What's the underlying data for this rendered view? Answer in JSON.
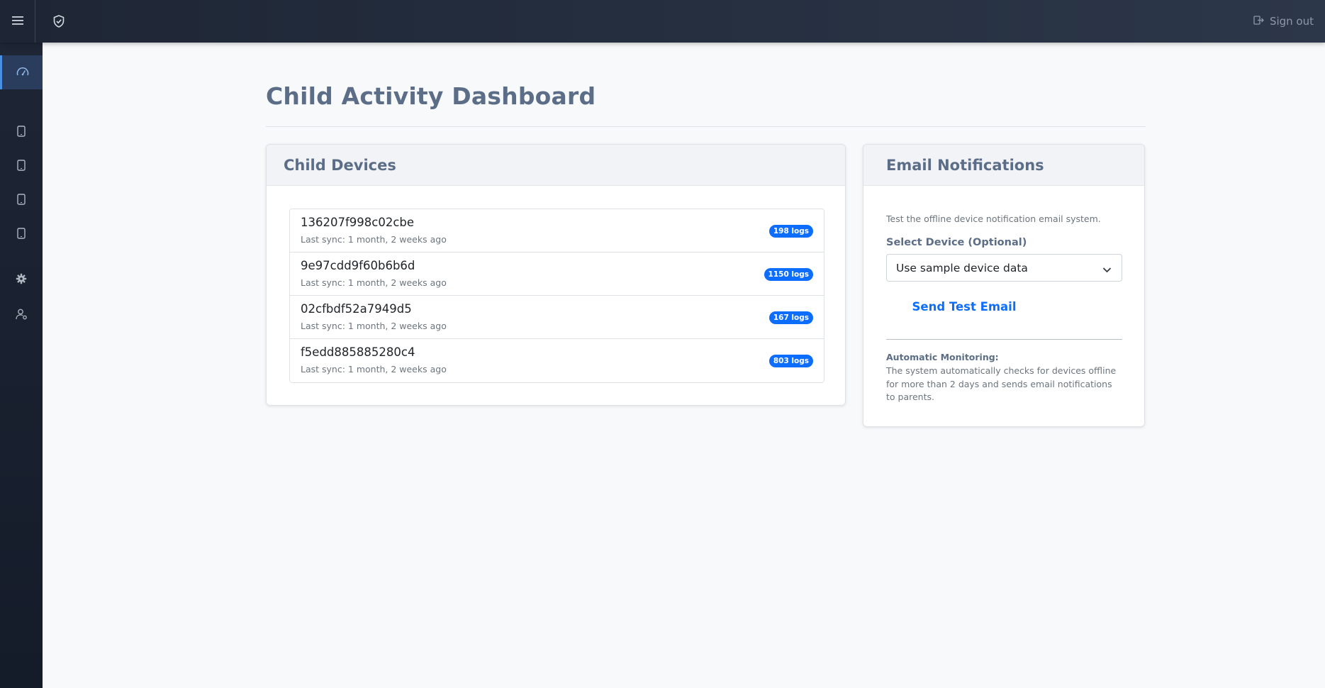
{
  "topbar": {
    "menu_icon": "hamburger-menu-icon",
    "brand_icon": "shield-check-icon",
    "signout_label": "Sign out",
    "signout_icon": "sign-out-icon"
  },
  "sidebar": {
    "items": [
      {
        "icon": "dashboard-gauge-icon",
        "active": true
      },
      {
        "icon": "phone-icon"
      },
      {
        "icon": "phone-icon"
      },
      {
        "icon": "phone-icon"
      },
      {
        "icon": "phone-icon"
      },
      {
        "icon": "gear-icon"
      },
      {
        "icon": "user-settings-icon"
      }
    ]
  },
  "page": {
    "title": "Child Activity Dashboard"
  },
  "devices": {
    "header": "Child Devices",
    "items": [
      {
        "id": "136207f998c02cbe",
        "sync": "Last sync: 1 month, 2 weeks ago",
        "logs": "198 logs"
      },
      {
        "id": "9e97cdd9f60b6b6d",
        "sync": "Last sync: 1 month, 2 weeks ago",
        "logs": "1150 logs"
      },
      {
        "id": "02cfbdf52a7949d5",
        "sync": "Last sync: 1 month, 2 weeks ago",
        "logs": "167 logs"
      },
      {
        "id": "f5edd885885280c4",
        "sync": "Last sync: 1 month, 2 weeks ago",
        "logs": "803 logs"
      }
    ]
  },
  "email": {
    "header": "Email Notifications",
    "description": "Test the offline device notification email system.",
    "select_label": "Select Device (Optional)",
    "select_value": "Use sample device data",
    "send_label": "Send Test Email",
    "auto_title": "Automatic Monitoring:",
    "auto_text": "The system automatically checks for devices offline for more than 2 days and sends email notifications to parents."
  },
  "colors": {
    "topbar": "#26303f",
    "sidebar": "#1a2130",
    "accent": "#0d6efd",
    "title": "#5c6e87"
  }
}
